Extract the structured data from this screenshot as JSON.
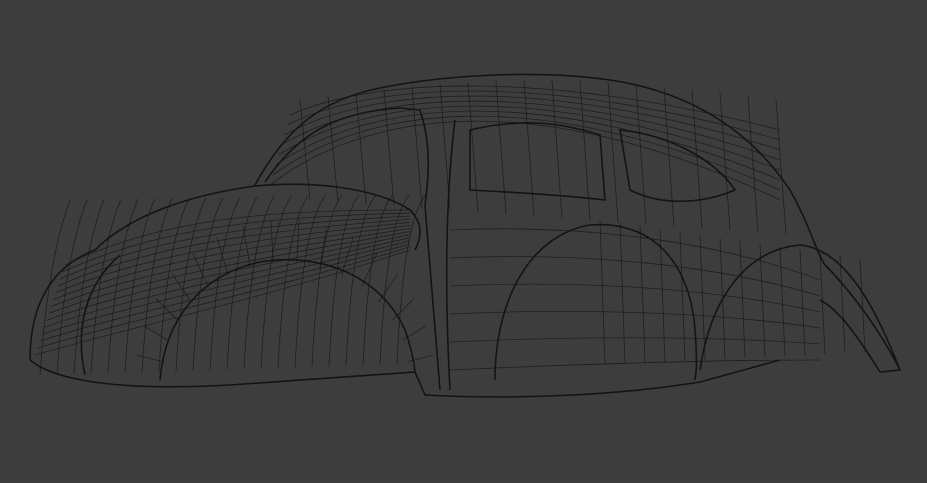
{
  "viewport": {
    "background_color": "#3d3d3d",
    "wire_color": "#1a1a1a",
    "object": "car-body-wireframe"
  }
}
